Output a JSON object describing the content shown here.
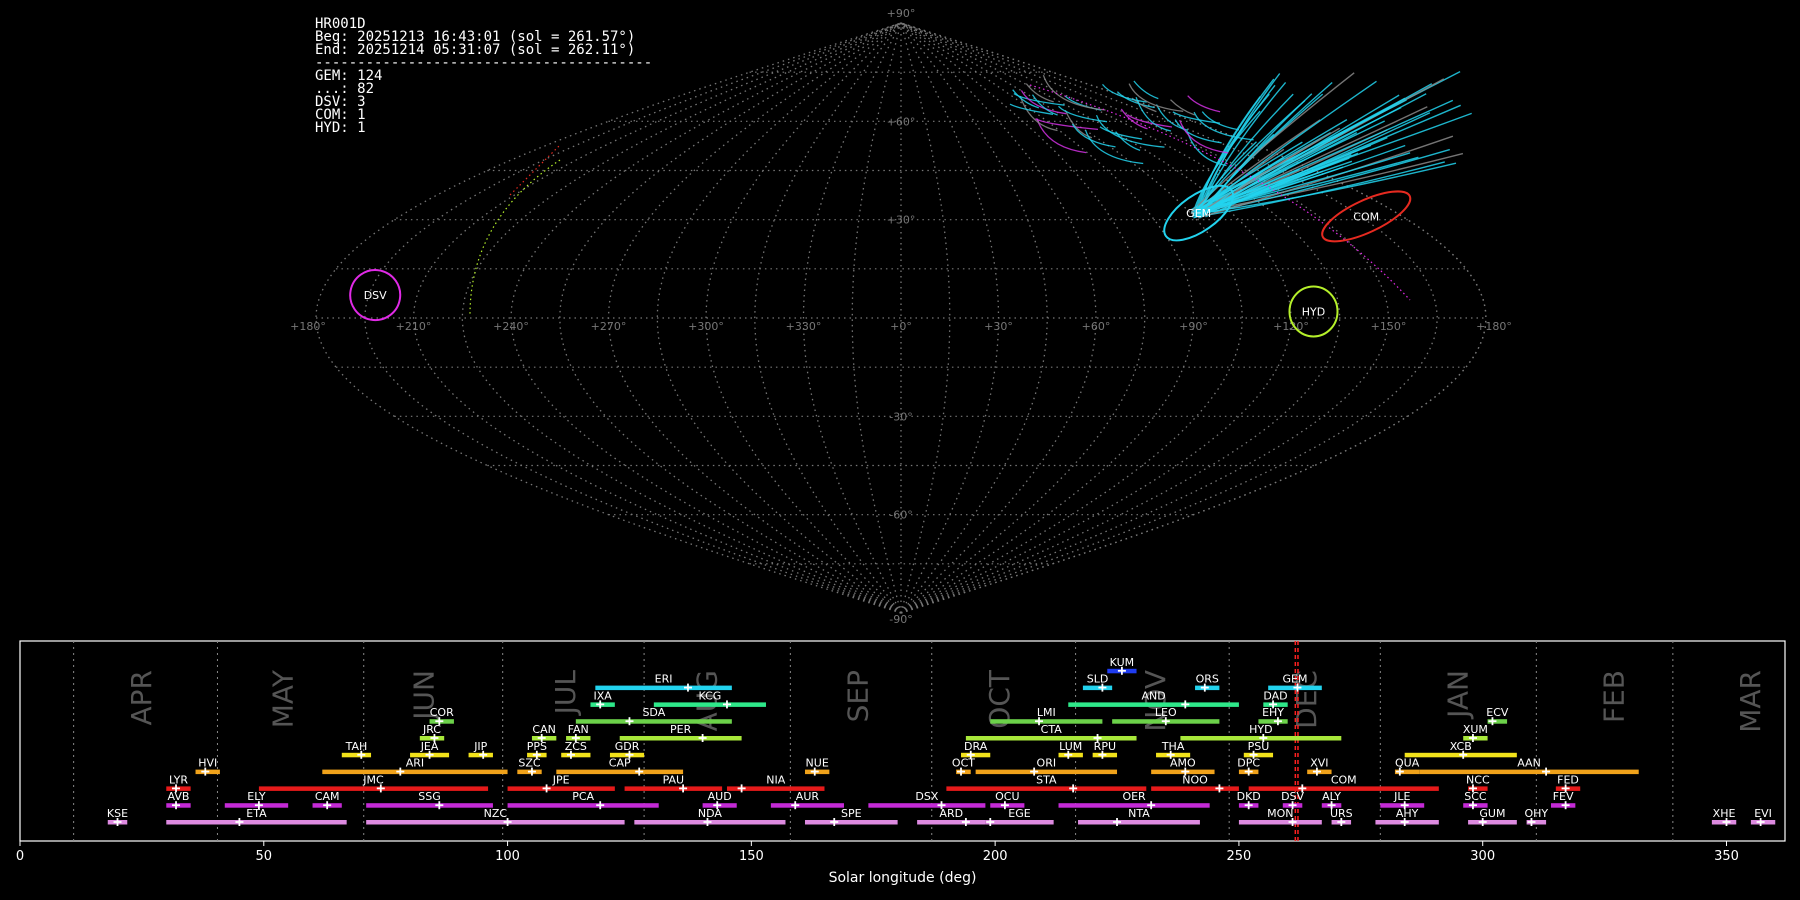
{
  "info": {
    "id": "HR001D",
    "beg": "Beg: 20251213 16:43:01 (sol = 261.57°)",
    "end": "End: 20251214 05:31:07 (sol = 262.11°)",
    "sep": "----------------------------------------",
    "counts": [
      "GEM: 124",
      "...: 82",
      "DSV: 3",
      "COM: 1",
      "HYD: 1"
    ]
  },
  "colors": {
    "GEM": "#22d3ee",
    "COM": "#e62a20",
    "HYD": "#b5f02a",
    "DSV": "#e02ae6",
    "sporadic": "#888888",
    "grid": "#777777",
    "solline": "#ff2020"
  },
  "chart_data": [
    {
      "type": "scatter",
      "projection": "sinusoidal",
      "lon_ticks": [
        "+180°",
        "+150°",
        "+120°",
        "+90°",
        "+60°",
        "+30°",
        "+0°",
        "+330°",
        "+300°",
        "+270°",
        "+240°",
        "+210°",
        "+180°"
      ],
      "lat_ticks": [
        "+90°",
        "+60°",
        "+30°",
        "-30°",
        "-60°",
        "-90°"
      ],
      "radiants": [
        {
          "name": "COM",
          "lon": 167,
          "lat": 31
        },
        {
          "name": "GEM",
          "lon": 108,
          "lat": 32
        },
        {
          "name": "HYD",
          "lon": 127,
          "lat": 2
        },
        {
          "name": "DSV",
          "lon": 197,
          "lat": 7
        }
      ]
    },
    {
      "type": "bar",
      "xlabel": "Solar longitude (deg)",
      "xlim": [
        0,
        362
      ],
      "xticks": [
        0,
        50,
        100,
        150,
        200,
        250,
        300,
        350
      ],
      "month_boundaries": [
        11,
        40.5,
        70.5,
        99,
        128,
        158,
        187,
        216.5,
        248,
        279,
        311,
        339
      ],
      "months": [
        {
          "label": "APR",
          "x": 25
        },
        {
          "label": "MAY",
          "x": 54
        },
        {
          "label": "JUN",
          "x": 83
        },
        {
          "label": "JUL",
          "x": 112
        },
        {
          "label": "AUG",
          "x": 141
        },
        {
          "label": "SEP",
          "x": 172
        },
        {
          "label": "OCT",
          "x": 201
        },
        {
          "label": "NOV",
          "x": 233
        },
        {
          "label": "DEC",
          "x": 264
        },
        {
          "label": "JAN",
          "x": 295
        },
        {
          "label": "FEB",
          "x": 327
        },
        {
          "label": "MAR",
          "x": 355
        }
      ],
      "current_sol": [
        261.57,
        262.11
      ],
      "showers": [
        {
          "code": "KUM",
          "start": 223,
          "end": 229,
          "peak": 226,
          "row": 10,
          "color": "#1f3cf0"
        },
        {
          "code": "ERI",
          "start": 118,
          "end": 146,
          "peak": 137,
          "row": 9,
          "color": "#22d3ee"
        },
        {
          "code": "SLD",
          "start": 218,
          "end": 224,
          "peak": 222,
          "row": 9,
          "color": "#22d3ee"
        },
        {
          "code": "ORS",
          "start": 241,
          "end": 246,
          "peak": 243,
          "row": 9,
          "color": "#22d3ee"
        },
        {
          "code": "GEM",
          "start": 256,
          "end": 267,
          "peak": 262,
          "row": 9,
          "color": "#22d3ee"
        },
        {
          "code": "IXA",
          "start": 117,
          "end": 122,
          "peak": 119,
          "row": 8,
          "color": "#2ee88a"
        },
        {
          "code": "KCG",
          "start": 130,
          "end": 153,
          "peak": 145,
          "row": 8,
          "color": "#2ee88a"
        },
        {
          "code": "AND",
          "start": 215,
          "end": 250,
          "peak": 239,
          "row": 8,
          "color": "#2ee88a"
        },
        {
          "code": "DAD",
          "start": 255,
          "end": 260,
          "peak": 257,
          "row": 8,
          "color": "#2ee88a"
        },
        {
          "code": "COR",
          "start": 84,
          "end": 89,
          "peak": 86,
          "row": 7,
          "color": "#6cd24a"
        },
        {
          "code": "SDA",
          "start": 114,
          "end": 146,
          "peak": 125,
          "row": 7,
          "color": "#6cd24a"
        },
        {
          "code": "LMI",
          "start": 199,
          "end": 222,
          "peak": 209,
          "row": 7,
          "color": "#6cd24a"
        },
        {
          "code": "LEO",
          "start": 224,
          "end": 246,
          "peak": 235,
          "row": 7,
          "color": "#6cd24a"
        },
        {
          "code": "EHY",
          "start": 254,
          "end": 260,
          "peak": 258,
          "row": 7,
          "color": "#6cd24a"
        },
        {
          "code": "ECV",
          "start": 301,
          "end": 305,
          "peak": 302,
          "row": 7,
          "color": "#6cd24a"
        },
        {
          "code": "JRC",
          "start": 82,
          "end": 87,
          "peak": 85,
          "row": 6,
          "color": "#a8e83a"
        },
        {
          "code": "CAN",
          "start": 105,
          "end": 110,
          "peak": 107,
          "row": 6,
          "color": "#a8e83a"
        },
        {
          "code": "FAN",
          "start": 112,
          "end": 117,
          "peak": 114,
          "row": 6,
          "color": "#a8e83a"
        },
        {
          "code": "PER",
          "start": 123,
          "end": 148,
          "peak": 140,
          "row": 6,
          "color": "#a8e83a"
        },
        {
          "code": "CTA",
          "start": 194,
          "end": 229,
          "peak": 221,
          "row": 6,
          "color": "#a8e83a"
        },
        {
          "code": "HYD",
          "start": 238,
          "end": 271,
          "peak": 255,
          "row": 6,
          "color": "#a8e83a"
        },
        {
          "code": "XUM",
          "start": 296,
          "end": 301,
          "peak": 298,
          "row": 6,
          "color": "#a8e83a"
        },
        {
          "code": "TAH",
          "start": 66,
          "end": 72,
          "peak": 70,
          "row": 5,
          "color": "#f2e21a"
        },
        {
          "code": "JEA",
          "start": 80,
          "end": 88,
          "peak": 84,
          "row": 5,
          "color": "#f2e21a"
        },
        {
          "code": "JIP",
          "start": 92,
          "end": 97,
          "peak": 95,
          "row": 5,
          "color": "#f2e21a"
        },
        {
          "code": "PPS",
          "start": 104,
          "end": 108,
          "peak": 106,
          "row": 5,
          "color": "#f2e21a"
        },
        {
          "code": "ZCS",
          "start": 111,
          "end": 117,
          "peak": 113,
          "row": 5,
          "color": "#f2e21a"
        },
        {
          "code": "GDR",
          "start": 121,
          "end": 128,
          "peak": 125,
          "row": 5,
          "color": "#f2e21a"
        },
        {
          "code": "DRA",
          "start": 193,
          "end": 199,
          "peak": 195,
          "row": 5,
          "color": "#f2e21a"
        },
        {
          "code": "LUM",
          "start": 213,
          "end": 218,
          "peak": 215,
          "row": 5,
          "color": "#f2e21a"
        },
        {
          "code": "RPU",
          "start": 220,
          "end": 225,
          "peak": 222,
          "row": 5,
          "color": "#f2e21a"
        },
        {
          "code": "THA",
          "start": 233,
          "end": 240,
          "peak": 236,
          "row": 5,
          "color": "#f2e21a"
        },
        {
          "code": "PSU",
          "start": 251,
          "end": 257,
          "peak": 253,
          "row": 5,
          "color": "#f2e21a"
        },
        {
          "code": "XCB",
          "start": 284,
          "end": 307,
          "peak": 296,
          "row": 5,
          "color": "#f2e21a"
        },
        {
          "code": "HVI",
          "start": 36,
          "end": 41,
          "peak": 38,
          "row": 4,
          "color": "#f0a21a"
        },
        {
          "code": "ARI",
          "start": 62,
          "end": 100,
          "peak": 78,
          "row": 4,
          "color": "#f0a21a"
        },
        {
          "code": "SZC",
          "start": 102,
          "end": 107,
          "peak": 105,
          "row": 4,
          "color": "#f0a21a"
        },
        {
          "code": "CAP",
          "start": 110,
          "end": 136,
          "peak": 127,
          "row": 4,
          "color": "#f0a21a"
        },
        {
          "code": "NUE",
          "start": 161,
          "end": 166,
          "peak": 163,
          "row": 4,
          "color": "#f0a21a"
        },
        {
          "code": "OCT",
          "start": 192,
          "end": 195,
          "peak": 193,
          "row": 4,
          "color": "#f0a21a"
        },
        {
          "code": "ORI",
          "start": 196,
          "end": 225,
          "peak": 208,
          "row": 4,
          "color": "#f0a21a"
        },
        {
          "code": "AMO",
          "start": 232,
          "end": 245,
          "peak": 239,
          "row": 4,
          "color": "#f0a21a"
        },
        {
          "code": "DPC",
          "start": 250,
          "end": 254,
          "peak": 252,
          "row": 4,
          "color": "#f0a21a"
        },
        {
          "code": "XVI",
          "start": 264,
          "end": 269,
          "peak": 266,
          "row": 4,
          "color": "#f0a21a"
        },
        {
          "code": "QUA",
          "start": 282,
          "end": 287,
          "peak": 283,
          "row": 4,
          "color": "#f0a21a"
        },
        {
          "code": "AAN",
          "start": 287,
          "end": 332,
          "peak": 313,
          "row": 4,
          "color": "#f0a21a"
        },
        {
          "code": "LYR",
          "start": 30,
          "end": 35,
          "peak": 32,
          "row": 3,
          "color": "#e61a1a"
        },
        {
          "code": "JMC",
          "start": 49,
          "end": 96,
          "peak": 74,
          "row": 3,
          "color": "#e61a1a"
        },
        {
          "code": "JPE",
          "start": 100,
          "end": 122,
          "peak": 108,
          "row": 3,
          "color": "#e61a1a"
        },
        {
          "code": "PAU",
          "start": 124,
          "end": 144,
          "peak": 136,
          "row": 3,
          "color": "#e61a1a"
        },
        {
          "code": "NIA",
          "start": 145,
          "end": 165,
          "peak": 148,
          "row": 3,
          "color": "#e61a1a"
        },
        {
          "code": "STA",
          "start": 190,
          "end": 231,
          "peak": 216,
          "row": 3,
          "color": "#e61a1a"
        },
        {
          "code": "NOO",
          "start": 232,
          "end": 250,
          "peak": 246,
          "row": 3,
          "color": "#e61a1a"
        },
        {
          "code": "COM",
          "start": 252,
          "end": 291,
          "peak": 263,
          "row": 3,
          "color": "#e61a1a"
        },
        {
          "code": "NCC",
          "start": 297,
          "end": 301,
          "peak": 298,
          "row": 3,
          "color": "#e61a1a"
        },
        {
          "code": "FED",
          "start": 315,
          "end": 320,
          "peak": 317,
          "row": 3,
          "color": "#e61a1a"
        },
        {
          "code": "AVB",
          "start": 30,
          "end": 35,
          "peak": 32,
          "row": 2,
          "color": "#c42ad6"
        },
        {
          "code": "ELY",
          "start": 42,
          "end": 55,
          "peak": 49,
          "row": 2,
          "color": "#c42ad6"
        },
        {
          "code": "CAM",
          "start": 60,
          "end": 66,
          "peak": 63,
          "row": 2,
          "color": "#c42ad6"
        },
        {
          "code": "SSG",
          "start": 71,
          "end": 97,
          "peak": 86,
          "row": 2,
          "color": "#c42ad6"
        },
        {
          "code": "PCA",
          "start": 100,
          "end": 131,
          "peak": 119,
          "row": 2,
          "color": "#c42ad6"
        },
        {
          "code": "AUD",
          "start": 140,
          "end": 147,
          "peak": 143,
          "row": 2,
          "color": "#c42ad6"
        },
        {
          "code": "AUR",
          "start": 154,
          "end": 169,
          "peak": 159,
          "row": 2,
          "color": "#c42ad6"
        },
        {
          "code": "DSX",
          "start": 174,
          "end": 198,
          "peak": 189,
          "row": 2,
          "color": "#c42ad6"
        },
        {
          "code": "OCU",
          "start": 199,
          "end": 206,
          "peak": 202,
          "row": 2,
          "color": "#c42ad6"
        },
        {
          "code": "OER",
          "start": 213,
          "end": 244,
          "peak": 232,
          "row": 2,
          "color": "#c42ad6"
        },
        {
          "code": "DKD",
          "start": 250,
          "end": 254,
          "peak": 252,
          "row": 2,
          "color": "#c42ad6"
        },
        {
          "code": "DSV",
          "start": 259,
          "end": 263,
          "peak": 261,
          "row": 2,
          "color": "#c42ad6"
        },
        {
          "code": "ALY",
          "start": 267,
          "end": 271,
          "peak": 269,
          "row": 2,
          "color": "#c42ad6"
        },
        {
          "code": "JLE",
          "start": 279,
          "end": 288,
          "peak": 284,
          "row": 2,
          "color": "#c42ad6"
        },
        {
          "code": "SCC",
          "start": 296,
          "end": 301,
          "peak": 298,
          "row": 2,
          "color": "#c42ad6"
        },
        {
          "code": "FEV",
          "start": 314,
          "end": 319,
          "peak": 317,
          "row": 2,
          "color": "#c42ad6"
        },
        {
          "code": "KSE",
          "start": 18,
          "end": 22,
          "peak": 20,
          "row": 1,
          "color": "#dd8ae0"
        },
        {
          "code": "ETA",
          "start": 30,
          "end": 67,
          "peak": 45,
          "row": 1,
          "color": "#dd8ae0"
        },
        {
          "code": "NZC",
          "start": 71,
          "end": 124,
          "peak": 100,
          "row": 1,
          "color": "#dd8ae0"
        },
        {
          "code": "NDA",
          "start": 126,
          "end": 157,
          "peak": 141,
          "row": 1,
          "color": "#dd8ae0"
        },
        {
          "code": "SPE",
          "start": 161,
          "end": 180,
          "peak": 167,
          "row": 1,
          "color": "#dd8ae0"
        },
        {
          "code": "ARD",
          "start": 184,
          "end": 198,
          "peak": 194,
          "row": 1,
          "color": "#dd8ae0"
        },
        {
          "code": "EGE",
          "start": 198,
          "end": 212,
          "peak": 199,
          "row": 1,
          "color": "#dd8ae0"
        },
        {
          "code": "NTA",
          "start": 217,
          "end": 242,
          "peak": 225,
          "row": 1,
          "color": "#dd8ae0"
        },
        {
          "code": "MON",
          "start": 250,
          "end": 267,
          "peak": 261,
          "row": 1,
          "color": "#dd8ae0"
        },
        {
          "code": "URS",
          "start": 269,
          "end": 273,
          "peak": 271,
          "row": 1,
          "color": "#dd8ae0"
        },
        {
          "code": "AHY",
          "start": 278,
          "end": 291,
          "peak": 284,
          "row": 1,
          "color": "#dd8ae0"
        },
        {
          "code": "GUM",
          "start": 297,
          "end": 307,
          "peak": 300,
          "row": 1,
          "color": "#dd8ae0"
        },
        {
          "code": "OHY",
          "start": 309,
          "end": 313,
          "peak": 310,
          "row": 1,
          "color": "#dd8ae0"
        },
        {
          "code": "XHE",
          "start": 347,
          "end": 352,
          "peak": 350,
          "row": 1,
          "color": "#dd8ae0"
        },
        {
          "code": "EVI",
          "start": 355,
          "end": 360,
          "peak": 357,
          "row": 1,
          "color": "#dd8ae0"
        }
      ]
    }
  ]
}
